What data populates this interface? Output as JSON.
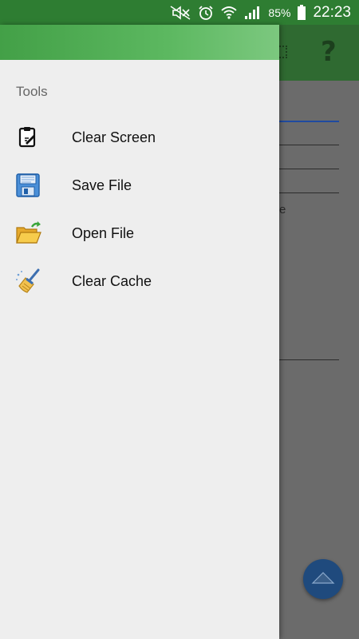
{
  "status_bar": {
    "battery_percent": "85%",
    "time": "22:23",
    "icons": [
      "mute-icon",
      "alarm-icon",
      "wifi-icon",
      "signal-icon",
      "battery-icon"
    ]
  },
  "background_app": {
    "toolbar_icons": [
      "grid-menu-icon",
      "help-icon"
    ],
    "help_glyph": "?",
    "text_fragment": "e",
    "fab_icon": "chevron-up-icon"
  },
  "drawer": {
    "section_title": "Tools",
    "items": [
      {
        "label": "Clear Screen",
        "icon": "clipboard-icon"
      },
      {
        "label": "Save File",
        "icon": "floppy-disk-icon"
      },
      {
        "label": "Open File",
        "icon": "open-folder-icon"
      },
      {
        "label": "Clear Cache",
        "icon": "broom-icon"
      }
    ]
  }
}
